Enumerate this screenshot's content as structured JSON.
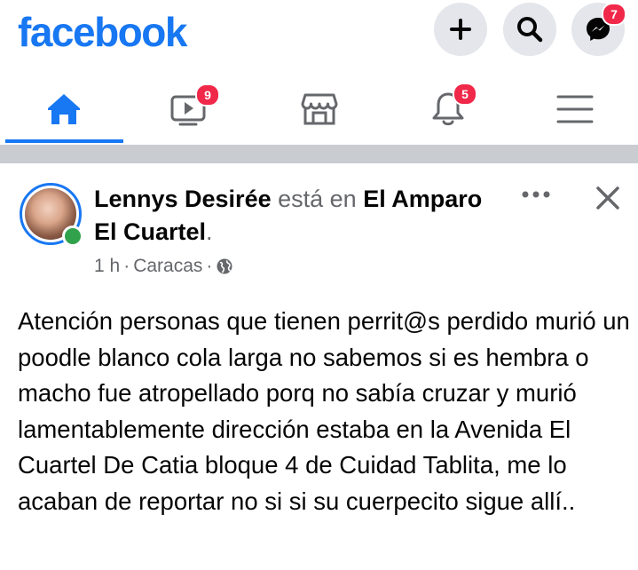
{
  "app": {
    "logo_text": "facebook",
    "brand_color": "#1877f2"
  },
  "header": {
    "actions": [
      {
        "icon": "plus-icon"
      },
      {
        "icon": "search-icon"
      },
      {
        "icon": "messenger-icon",
        "badge": "7"
      }
    ]
  },
  "tabs": [
    {
      "icon": "home-icon",
      "active": true
    },
    {
      "icon": "video-icon",
      "badge": "9"
    },
    {
      "icon": "marketplace-icon"
    },
    {
      "icon": "bell-icon",
      "badge": "5"
    },
    {
      "icon": "menu-icon"
    }
  ],
  "post": {
    "author": "Lennys Desirée",
    "connector": "está en",
    "place": "El Amparo El Cuartel",
    "time": "1 h",
    "location": "Caracas",
    "privacy_icon": "globe-icon",
    "text": "Atención personas que tienen perrit@s perdido murió un poodle blanco cola larga no sabemos si es hembra o macho fue atropellado porq no sabía cruzar y murió lamentablemente dirección estaba en la Avenida El Cuartel De Catia bloque 4 de Cuidad Tablita, me lo acaban de reportar no si si su cuerpecito sigue allí.."
  }
}
